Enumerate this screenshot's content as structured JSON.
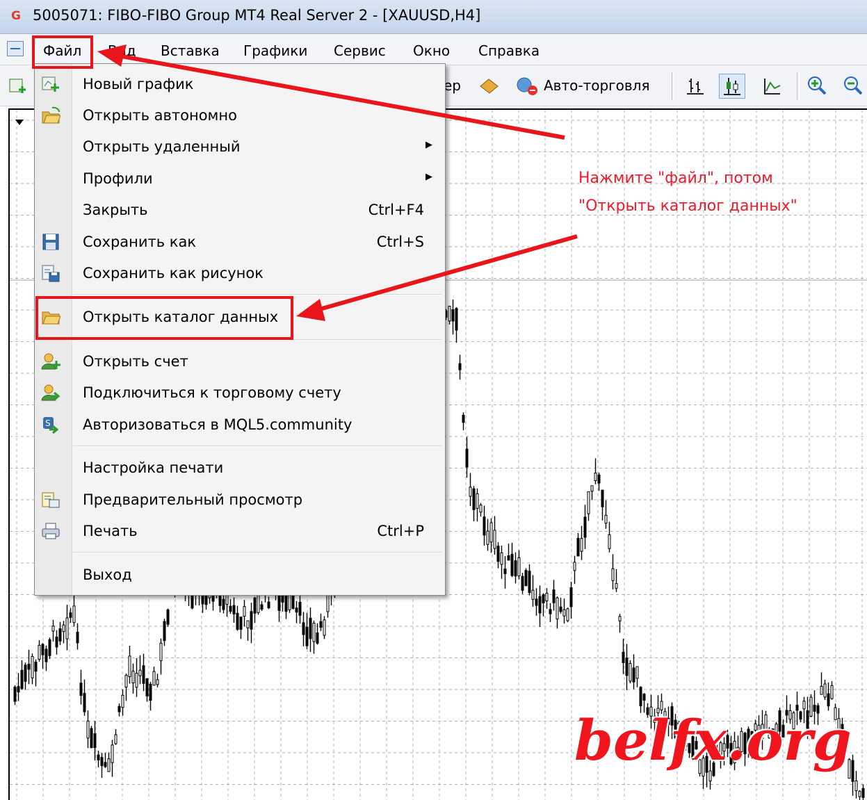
{
  "window": {
    "title": "5005071: FIBO-FIBO Group MT4 Real Server 2 - [XAUUSD,H4]"
  },
  "menubar": {
    "items": [
      "Файл",
      "Вид",
      "Вставка",
      "Графики",
      "Сервис",
      "Окно",
      "Справка"
    ]
  },
  "toolbar": {
    "partial_label": "ер",
    "autotrade_label": "Авто-торговля"
  },
  "file_menu": {
    "items": [
      {
        "label": "Новый график",
        "shortcut": "",
        "icon": "new-chart-icon"
      },
      {
        "label": "Открыть автономно",
        "shortcut": "",
        "icon": "open-folder-icon"
      },
      {
        "label": "Открыть удаленный",
        "shortcut": "",
        "submenu": true
      },
      {
        "label": "Профили",
        "shortcut": "",
        "submenu": true
      },
      {
        "label": "Закрыть",
        "shortcut": "Ctrl+F4"
      },
      {
        "label": "Сохранить как",
        "shortcut": "Ctrl+S",
        "icon": "floppy-icon"
      },
      {
        "label": "Сохранить как рисунок",
        "shortcut": "",
        "icon": "save-picture-icon"
      },
      {
        "label": "Открыть каталог данных",
        "shortcut": "",
        "icon": "folder-icon"
      },
      {
        "label": "Открыть счет",
        "shortcut": "",
        "icon": "user-add-icon"
      },
      {
        "label": "Подключиться к торговому счету",
        "shortcut": "",
        "icon": "user-login-icon"
      },
      {
        "label": "Авторизоваться в MQL5.community",
        "shortcut": "",
        "icon": "mql5-login-icon"
      },
      {
        "label": "Настройка печати",
        "shortcut": ""
      },
      {
        "label": "Предварительный просмотр",
        "shortcut": "",
        "icon": "print-preview-icon"
      },
      {
        "label": "Печать",
        "shortcut": "Ctrl+P",
        "icon": "printer-icon"
      },
      {
        "label": "Выход",
        "shortcut": ""
      }
    ]
  },
  "annotation": {
    "line1": "Нажмите \"файл\", потом",
    "line2": "\"Открыть каталог данных\""
  },
  "watermark": "belfx.org",
  "colors": {
    "highlight": "#e8151b",
    "annotation": "#f0192a",
    "candles": "#000000",
    "grid": "#b0b0b0"
  }
}
